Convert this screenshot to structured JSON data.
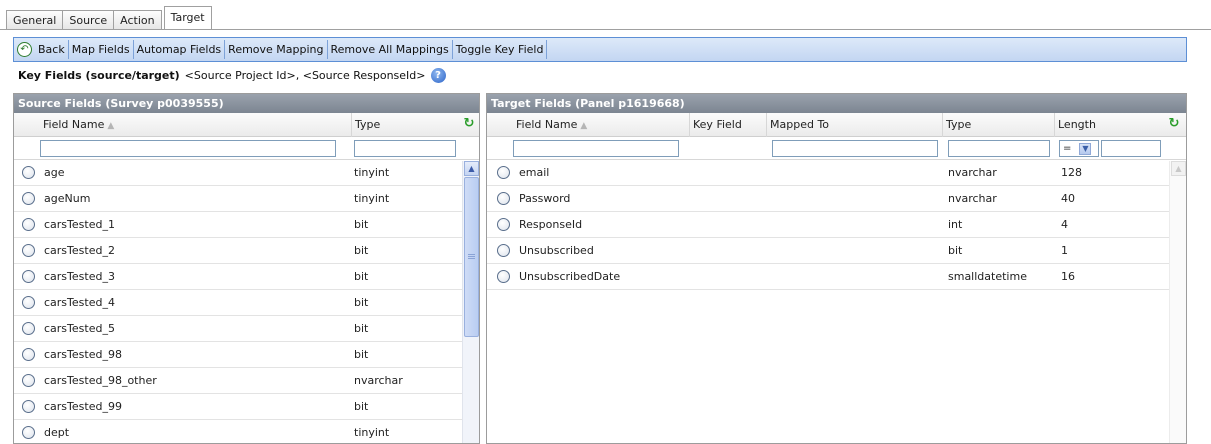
{
  "tabs": [
    {
      "label": "General"
    },
    {
      "label": "Source"
    },
    {
      "label": "Action"
    },
    {
      "label": "Target",
      "active": true
    }
  ],
  "toolbar": {
    "buttons": [
      {
        "label": "Back",
        "icon": "back-arrow-icon"
      },
      {
        "label": "Map Fields"
      },
      {
        "label": "Automap Fields"
      },
      {
        "label": "Remove Mapping"
      },
      {
        "label": "Remove All Mappings"
      },
      {
        "label": "Toggle Key Field"
      }
    ]
  },
  "key_fields": {
    "label": "Key Fields (source/target)",
    "value": "<Source Project Id>, <Source ResponseId>",
    "help_icon": "help-icon"
  },
  "source_panel": {
    "title": "Source Fields (Survey p0039555)",
    "columns": {
      "field_name": "Field Name",
      "type": "Type"
    },
    "rows": [
      {
        "name": "age",
        "type": "tinyint"
      },
      {
        "name": "ageNum",
        "type": "tinyint"
      },
      {
        "name": "carsTested_1",
        "type": "bit"
      },
      {
        "name": "carsTested_2",
        "type": "bit"
      },
      {
        "name": "carsTested_3",
        "type": "bit"
      },
      {
        "name": "carsTested_4",
        "type": "bit"
      },
      {
        "name": "carsTested_5",
        "type": "bit"
      },
      {
        "name": "carsTested_98",
        "type": "bit"
      },
      {
        "name": "carsTested_98_other",
        "type": "nvarchar"
      },
      {
        "name": "carsTested_99",
        "type": "bit"
      },
      {
        "name": "dept",
        "type": "tinyint"
      }
    ]
  },
  "target_panel": {
    "title": "Target Fields (Panel p1619668)",
    "columns": {
      "field_name": "Field Name",
      "key_field": "Key Field",
      "mapped_to": "Mapped To",
      "type": "Type",
      "length": "Length"
    },
    "length_operator": "=",
    "rows": [
      {
        "name": "email",
        "type": "nvarchar",
        "length": "128"
      },
      {
        "name": "Password",
        "type": "nvarchar",
        "length": "40"
      },
      {
        "name": "ResponseId",
        "type": "int",
        "length": "4"
      },
      {
        "name": "Unsubscribed",
        "type": "bit",
        "length": "1"
      },
      {
        "name": "UnsubscribedDate",
        "type": "smalldatetime",
        "length": "16"
      }
    ]
  },
  "colors": {
    "toolbar_border": "#5d8fd5",
    "panel_header": "#7c8591",
    "refresh_green": "#2a9d2a"
  }
}
